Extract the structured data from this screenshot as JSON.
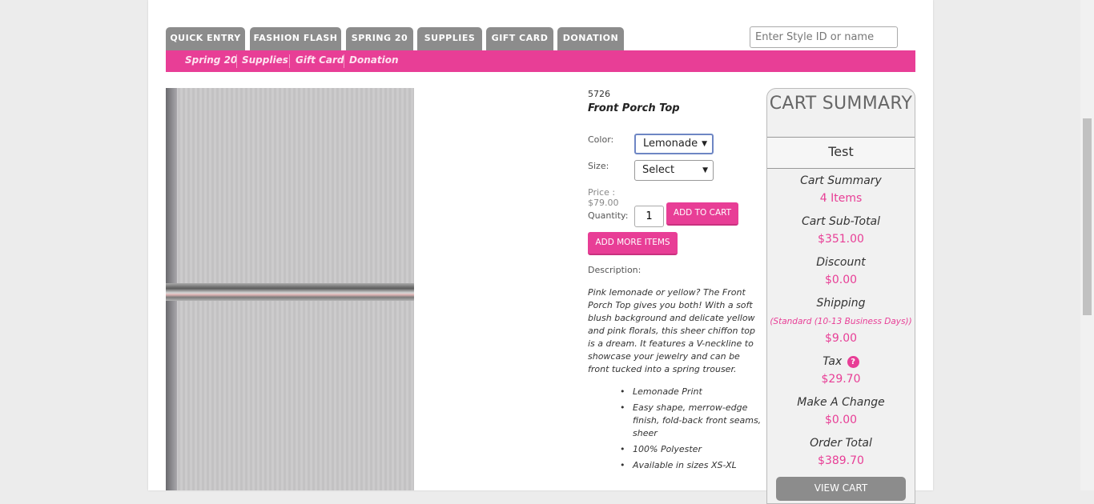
{
  "tabs": [
    "QUICK ENTRY",
    "FASHION FLASH",
    "SPRING 20",
    "SUPPLIES",
    "GIFT CARD",
    "DONATION"
  ],
  "search": {
    "placeholder": "Enter Style ID or name"
  },
  "subnav": [
    "Spring 20",
    "Supplies",
    "Gift Card",
    "Donation"
  ],
  "product": {
    "sku": "5726",
    "name": "Front Porch Top",
    "color_label": "Color:",
    "color_value": "Lemonade",
    "size_label": "Size:",
    "size_value": "Select",
    "price": "Price : $79.00",
    "quantity_label": "Quantity:",
    "quantity_value": "1",
    "add_to_cart": "ADD TO CART",
    "add_more": "ADD MORE ITEMS",
    "description_label": "Description:",
    "description": "Pink lemonade or yellow? The Front Porch Top gives you both! With a soft blush background and delicate yellow and pink florals, this sheer chiffon top is a dream. It features a V-neckline to showcase your jewelry and can be front tucked into a spring trouser.",
    "bullets": [
      "Lemonade Print",
      "Easy shape, merrow-edge finish, fold-back front seams, sheer",
      "100% Polyester",
      "Available in sizes XS-XL"
    ]
  },
  "cart": {
    "title": "CART SUMMARY",
    "name": "Test",
    "summary_label": "Cart Summary",
    "summary_value": "4 Items",
    "subtotal_label": "Cart Sub-Total",
    "subtotal_value": "$351.00",
    "discount_label": "Discount",
    "discount_value": "$0.00",
    "shipping_label": "Shipping",
    "shipping_note": "(Standard (10-13 Business Days))",
    "shipping_value": "$9.00",
    "tax_label": "Tax",
    "tax_help": "?",
    "tax_value": "$29.70",
    "change_label": "Make A Change",
    "change_value": "$0.00",
    "total_label": "Order Total",
    "total_value": "$389.70",
    "view_cart": "VIEW CART"
  },
  "colors": {
    "accent": "#e83e96",
    "tab": "#8c8c8c"
  }
}
